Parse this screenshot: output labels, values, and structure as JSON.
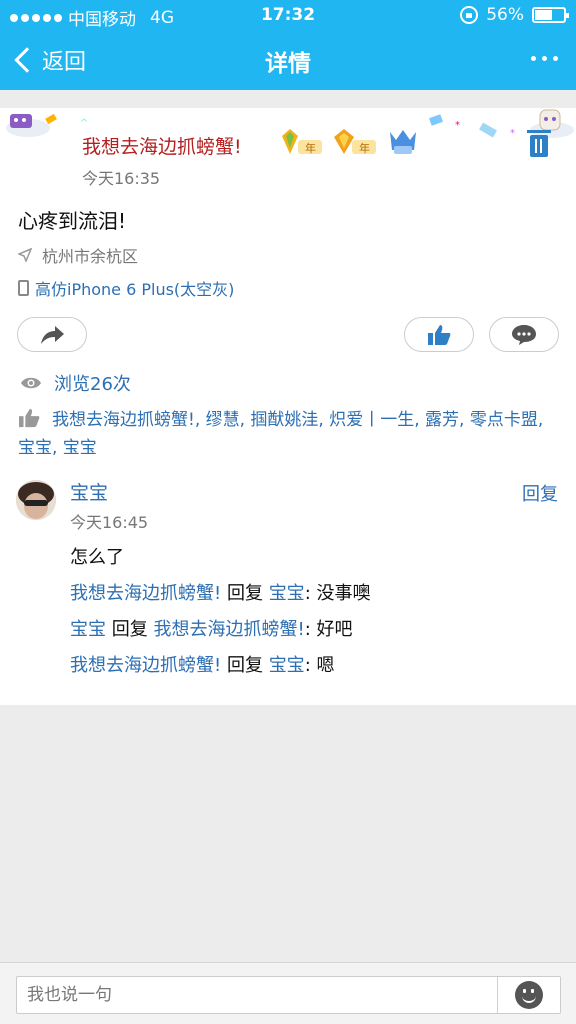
{
  "status_bar": {
    "carrier": "中国移动",
    "network": "4G",
    "time": "17:32",
    "battery": "56%",
    "battery_level": 0.56
  },
  "nav": {
    "back_label": "返回",
    "title": "详情"
  },
  "post": {
    "author": "我想去海边抓螃蟹!",
    "time": "今天16:35",
    "content": "心疼到流泪!",
    "location": "杭州市余杭区",
    "device": "高仿iPhone 6 Plus(太空灰)",
    "views": "浏览26次",
    "likers": "我想去海边抓螃蟹!, 缪慧, 掴猷姚洼, 炽爱丨一生, 露芳, 零点卡盟, 宝宝, 宝宝"
  },
  "badges": [
    {
      "label": "年",
      "icon": "yellow-diamond-badge-icon"
    },
    {
      "label": "年",
      "icon": "gold-diamond-badge-icon"
    },
    {
      "label": "",
      "icon": "blue-crown-badge-icon"
    }
  ],
  "comment": {
    "name": "宝宝",
    "time": "今天16:45",
    "reply_button": "回复",
    "text": "怎么了",
    "replies": [
      {
        "from": "我想去海边抓螃蟹!",
        "verb": "回复",
        "to": "宝宝",
        "sep": ": ",
        "text": "没事噢"
      },
      {
        "from": "宝宝",
        "verb": "回复",
        "to": "我想去海边抓螃蟹!",
        "sep": ": ",
        "text": "好吧"
      },
      {
        "from": "我想去海边抓螃蟹!",
        "verb": "回复",
        "to": "宝宝",
        "sep": ": ",
        "text": "嗯"
      }
    ]
  },
  "input": {
    "placeholder": "我也说一句"
  },
  "colors": {
    "header": "#1fb6f2",
    "link": "#2d6fb3",
    "author_red": "#b51f1f"
  }
}
